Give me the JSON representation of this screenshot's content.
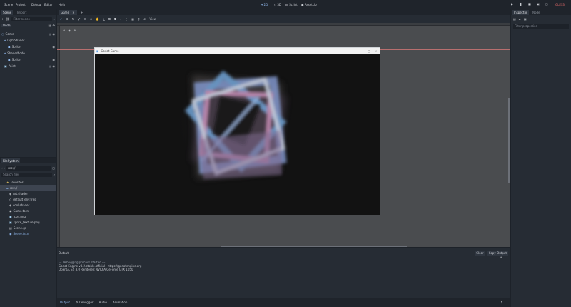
{
  "menubar": {
    "menus": [
      "Scene",
      "Project",
      "Debug",
      "Editor",
      "Help"
    ],
    "workspaces": [
      "2D",
      "3D",
      "Script",
      "AssetLib"
    ],
    "renderer": "GLES3"
  },
  "scene_dock": {
    "tabs": [
      "Scene",
      "Import"
    ],
    "filter_placeholder": "Filter nodes",
    "root_node_label": "Node",
    "tree": [
      {
        "label": "Game",
        "depth": 0
      },
      {
        "label": "LightShader",
        "depth": 1
      },
      {
        "label": "Sprite",
        "depth": 2
      },
      {
        "label": "ShaderNode",
        "depth": 1
      },
      {
        "label": "Sprite",
        "depth": 2
      },
      {
        "label": "Paint",
        "depth": 1
      }
    ]
  },
  "filesystem": {
    "tab": "FileSystem",
    "path": "res://",
    "search_placeholder": "Search files",
    "items": [
      {
        "label": "Favorites:",
        "icon": "star-icon"
      },
      {
        "label": "res://",
        "icon": "folder-icon",
        "selected": true
      },
      {
        "label": "Art.shader",
        "icon": "file-icon"
      },
      {
        "label": "default_env.tres",
        "icon": "file-icon"
      },
      {
        "label": "cool.shader",
        "icon": "file-icon"
      },
      {
        "label": "Game.tscn",
        "icon": "file-icon"
      },
      {
        "label": "icon.png",
        "icon": "image-icon"
      },
      {
        "label": "sprite_texture.png",
        "icon": "image-icon"
      },
      {
        "label": "Scene.gd",
        "icon": "script-icon"
      },
      {
        "label": "Scene.tscn",
        "icon": "file-icon"
      }
    ]
  },
  "center": {
    "scene_tab": "Game",
    "view_label": "View",
    "game_window_title": "Godot Game"
  },
  "output": {
    "title": "Output:",
    "clear_label": "Clear",
    "copy_label": "Copy Output",
    "lines": [
      "--- Debugging process started ---",
      "Godot Engine v3.2.stable.official - https://godotengine.org",
      "OpenGL ES 3.0 Renderer: NVIDIA GeForce GTX 1050"
    ]
  },
  "bottom_tabs": [
    "Output",
    "Debugger",
    "Audio",
    "Animation"
  ],
  "inspector": {
    "tabs": [
      "Inspector",
      "Node"
    ],
    "filter_placeholder": "Filter properties"
  },
  "colors": {
    "accent": "#5f9fe3",
    "panel": "#262c34",
    "viewport": "#4a4c4f"
  }
}
